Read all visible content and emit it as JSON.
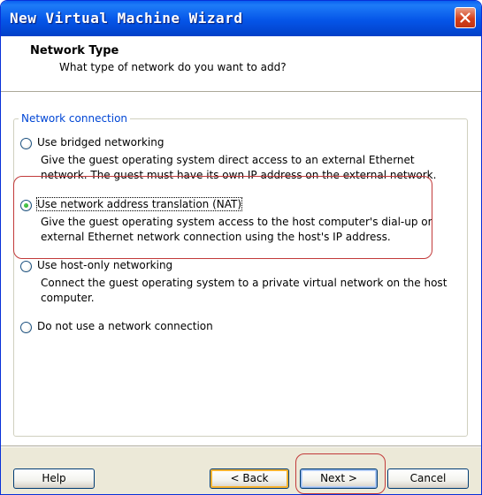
{
  "window": {
    "title": "New Virtual Machine Wizard"
  },
  "header": {
    "title": "Network Type",
    "subtitle": "What type of network do you want to add?"
  },
  "group": {
    "legend": "Network connection"
  },
  "options": [
    {
      "label": "Use bridged networking",
      "description": "Give the guest operating system direct access to an external Ethernet network. The guest must have its own IP address on the external network.",
      "selected": false
    },
    {
      "label": "Use network address translation (NAT)",
      "description": "Give the guest operating system access to the host computer's dial-up or external Ethernet network connection using the host's IP address.",
      "selected": true
    },
    {
      "label": "Use host-only networking",
      "description": "Connect the guest operating system to a private virtual network on the host computer.",
      "selected": false
    },
    {
      "label": "Do not use a network connection",
      "description": "",
      "selected": false
    }
  ],
  "buttons": {
    "help": "Help",
    "back": "< Back",
    "next": "Next >",
    "cancel": "Cancel"
  },
  "colors": {
    "title_bar": "#0555E8",
    "close_button": "#D5401A",
    "annotation_outline": "#C23A3A",
    "group_legend": "#0046D5"
  },
  "icons": {
    "close": "close-icon"
  }
}
